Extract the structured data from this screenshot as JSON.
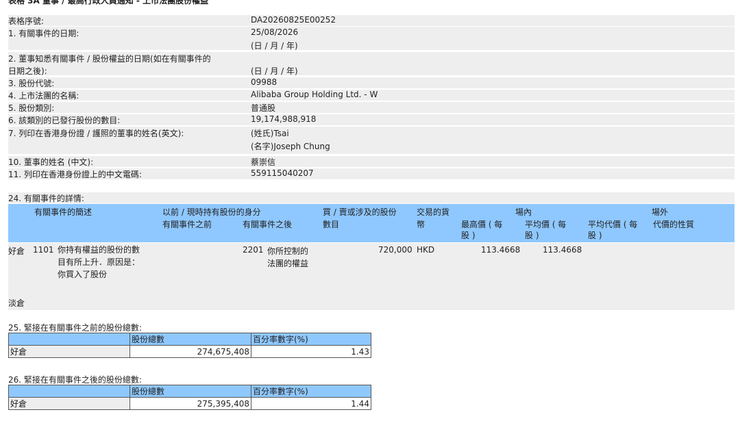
{
  "top_heading": "表格 3A 董事 / 最高行政人員通知 - 上市法團股份權益",
  "form": {
    "serial_label": "表格序號:",
    "serial_value": "DA20260825E00252",
    "event_date_label": "1. 有關事件的日期:",
    "event_date_value": "25/08/2026",
    "date_format_1": "(日 / 月 / 年)",
    "aware_date_label_1": "2. 董事知悉有關事件 / 股份權益的日期(如在有關事件的",
    "aware_date_label_2": "日期之後):",
    "date_format_2": "(日 / 月 / 年)",
    "stock_code_label": "3. 股份代號:",
    "stock_code_value": "09988",
    "corp_name_label": "4. 上市法團的名稱:",
    "corp_name_value": "Alibaba Group Holding Ltd. - W",
    "share_class_label": "5. 股份類別:",
    "share_class_value": "普通股",
    "issued_shares_label": "6. 該類別的已發行股份的數目:",
    "issued_shares_value": "19,174,988,918",
    "name_en_label": "7. 列印在香港身份證 / 護照的董事的姓名(英文):",
    "surname_value": "(姓氏)Tsai",
    "given_name_value": "(名字)Joseph Chung",
    "name_cn_label": "10. 董事的姓名 (中文):",
    "name_cn_value": "蔡崇信",
    "telecode_label": "11. 列印在香港身份證上的中文電碼:",
    "telecode_value": "559115040207"
  },
  "details": {
    "section_label": "24. 有關事件的詳情:",
    "header": {
      "desc": "有關事件的簡述",
      "capacity": "以前 / 現時持有股份的身分",
      "before": "有關事件之前",
      "after": "有關事件之後",
      "shares_1": "買 / 賣或涉及的股份",
      "shares_2": "數目",
      "currency_1": "交易的貨",
      "currency_2": "幣",
      "onex": "場內",
      "high_1": "最高價 ( 每",
      "high_2": "股 )",
      "avg_1": "平均價 ( 每",
      "avg_2": "股 )",
      "offex": "場外",
      "avgcons_1": "平均代價 ( 每",
      "avgcons_2": "股 )",
      "nature": "代價的性質"
    },
    "long_row": {
      "position": "好倉",
      "code": "1101",
      "desc_1": "你持有權益的股份的數",
      "desc_2": "目有所上升．原因是：",
      "desc_3": "你買入了股份",
      "after_code": "2201",
      "after_1": "你所控制的",
      "after_2": "法團的權益",
      "shares": "720,000",
      "currency": "HKD",
      "high": "113.4668",
      "avg": "113.4668"
    },
    "short_label": "淡倉"
  },
  "before_totals": {
    "label": "25. 緊接在有關事件之前的股份總數:",
    "col_total": "股份總數",
    "col_pct": "百分率數字(%)",
    "row_label": "好倉",
    "total": "274,675,408",
    "pct": "1.43"
  },
  "after_totals": {
    "label": "26. 緊接在有關事件之後的股份總數:",
    "col_total": "股份總數",
    "col_pct": "百分率數字(%)",
    "row_label": "好倉",
    "total": "275,395,408",
    "pct": "1.44"
  }
}
